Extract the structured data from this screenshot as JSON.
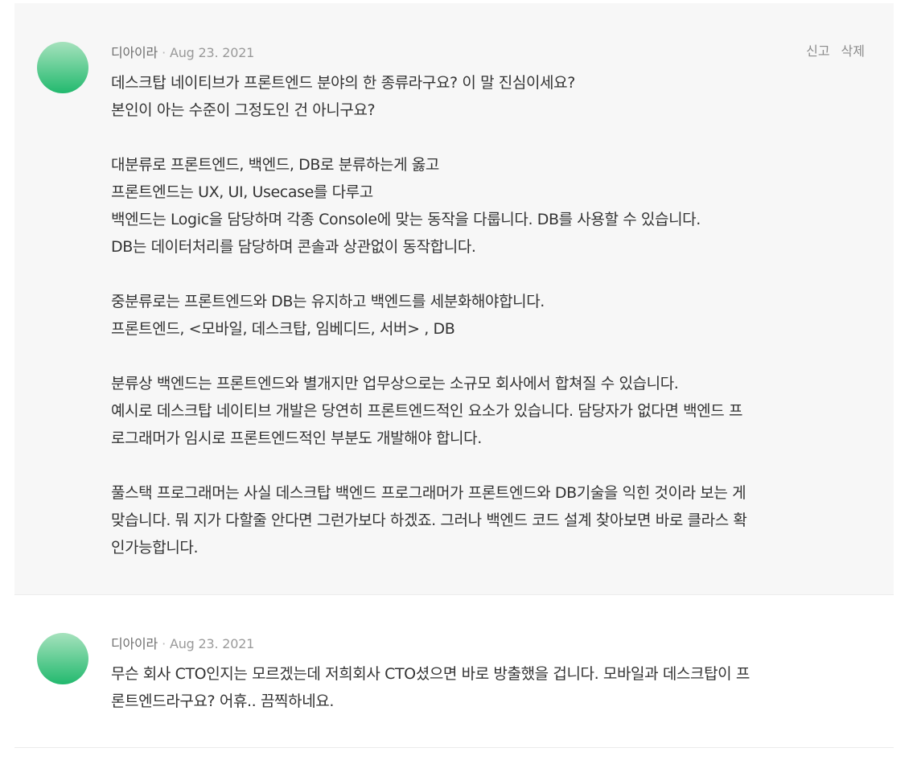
{
  "comments": [
    {
      "author": "디아이라",
      "separator": "·",
      "date": "Aug 23. 2021",
      "actions": {
        "report": "신고",
        "delete": "삭제"
      },
      "lines": [
        "데스크탑 네이티브가 프론트엔드 분야의 한 종류라구요? 이 말 진심이세요?",
        "본인이 아는 수준이 그정도인 건 아니구요?",
        "",
        "대분류로 프론트엔드, 백엔드, DB로 분류하는게 옳고",
        "프론트엔드는 UX, UI, Usecase를 다루고",
        "백엔드는 Logic을 담당하며 각종 Console에 맞는 동작을 다룹니다. DB를 사용할 수 있습니다.",
        "DB는 데이터처리를 담당하며 콘솔과 상관없이 동작합니다.",
        "",
        "중분류로는 프론트엔드와 DB는 유지하고 백엔드를 세분화해야합니다.",
        "프론트엔드, <모바일, 데스크탑, 임베디드, 서버> , DB",
        "",
        "분류상 백엔드는 프론트엔드와 별개지만 업무상으로는 소규모 회사에서 합쳐질 수 있습니다.",
        "예시로 데스크탑 네이티브 개발은 당연히 프론트엔드적인 요소가 있습니다. 담당자가 없다면 백엔드 프",
        "로그래머가 임시로 프론트엔드적인 부분도 개발해야 합니다.",
        "",
        "풀스택 프로그래머는 사실 데스크탑 백엔드 프로그래머가 프론트엔드와 DB기술을 익힌 것이라 보는 게",
        "맞습니다. 뭐 지가 다할줄 안다면 그런가보다 하겠죠. 그러나 백엔드 코드 설계 찾아보면 바로 클라스 확",
        "인가능합니다."
      ]
    },
    {
      "author": "디아이라",
      "separator": "·",
      "date": "Aug 23. 2021",
      "lines": [
        "무슨 회사 CTO인지는 모르겠는데 저희회사 CTO셨으면 바로 방출했을 겁니다. 모바일과 데스크탑이 프",
        "론트엔드라구요? 어휴.. 끔찍하네요."
      ]
    }
  ]
}
